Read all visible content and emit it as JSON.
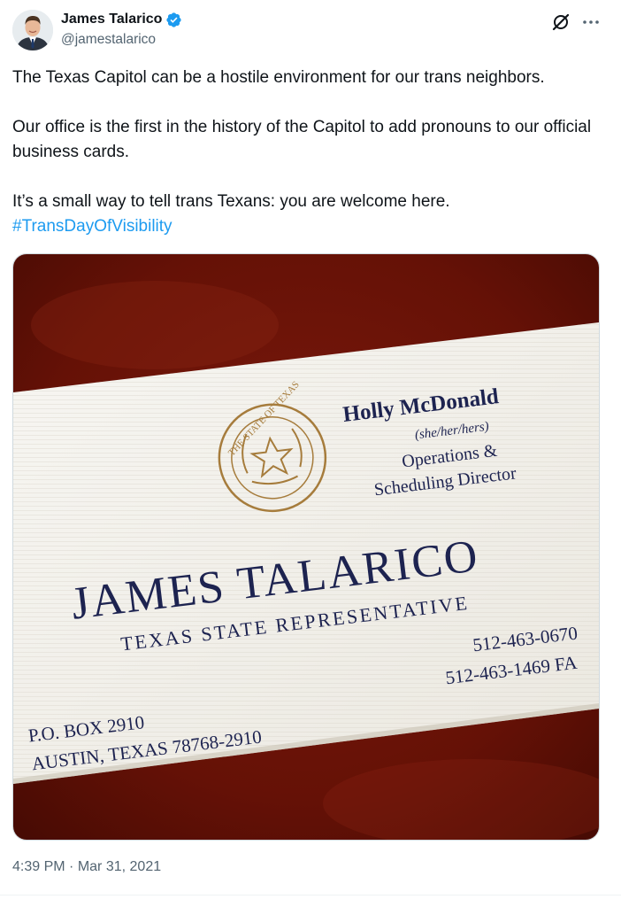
{
  "author": {
    "display_name": "James Talarico",
    "handle": "@jamestalarico",
    "verified_color": "#1d9bf0"
  },
  "tweet": {
    "paragraphs": [
      "The Texas Capitol can be a hostile environment for our trans neighbors.",
      "Our office is the first in the history of the Capitol to add pronouns to our official business cards.",
      "It’s a small way to tell trans Texans: you are welcome here."
    ],
    "hashtag": "#TransDayOfVisibility",
    "time": "4:39 PM",
    "separator": "·",
    "date": "Mar 31, 2021"
  },
  "media": {
    "card": {
      "seal_text": "THE STATE OF TEXAS",
      "staff_name": "Holly McDonald",
      "pronouns": "(she/her/hers)",
      "staff_title_line1": "Operations &",
      "staff_title_line2": "Scheduling Director",
      "rep_name": "JAMES TALARICO",
      "rep_title": "TEXAS STATE REPRESENTATIVE",
      "address_line1": "P.O. BOX 2910",
      "address_line2": "AUSTIN, TEXAS 78768-2910",
      "phone": "512-463-0670",
      "fax": "512-463-1469 FA"
    }
  },
  "icons": {
    "grok": "grok-icon",
    "more": "more-options-icon",
    "verified": "verified-badge-icon"
  },
  "colors": {
    "text_primary": "#0f1419",
    "text_secondary": "#536471",
    "link": "#1d9bf0",
    "background_fabric": "#6e1208",
    "card_paper": "#f4f2ec",
    "card_ink": "#1d2350",
    "seal_gold": "#a67c3c"
  }
}
